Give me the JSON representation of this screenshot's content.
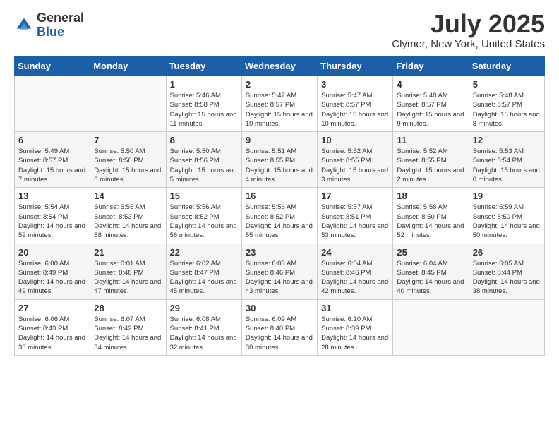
{
  "header": {
    "logo_line1": "General",
    "logo_line2": "Blue",
    "title": "July 2025",
    "location": "Clymer, New York, United States"
  },
  "weekdays": [
    "Sunday",
    "Monday",
    "Tuesday",
    "Wednesday",
    "Thursday",
    "Friday",
    "Saturday"
  ],
  "weeks": [
    [
      {
        "day": "",
        "sunrise": "",
        "sunset": "",
        "daylight": ""
      },
      {
        "day": "",
        "sunrise": "",
        "sunset": "",
        "daylight": ""
      },
      {
        "day": "1",
        "sunrise": "Sunrise: 5:46 AM",
        "sunset": "Sunset: 8:58 PM",
        "daylight": "Daylight: 15 hours and 11 minutes."
      },
      {
        "day": "2",
        "sunrise": "Sunrise: 5:47 AM",
        "sunset": "Sunset: 8:57 PM",
        "daylight": "Daylight: 15 hours and 10 minutes."
      },
      {
        "day": "3",
        "sunrise": "Sunrise: 5:47 AM",
        "sunset": "Sunset: 8:57 PM",
        "daylight": "Daylight: 15 hours and 10 minutes."
      },
      {
        "day": "4",
        "sunrise": "Sunrise: 5:48 AM",
        "sunset": "Sunset: 8:57 PM",
        "daylight": "Daylight: 15 hours and 9 minutes."
      },
      {
        "day": "5",
        "sunrise": "Sunrise: 5:48 AM",
        "sunset": "Sunset: 8:57 PM",
        "daylight": "Daylight: 15 hours and 8 minutes."
      }
    ],
    [
      {
        "day": "6",
        "sunrise": "Sunrise: 5:49 AM",
        "sunset": "Sunset: 8:57 PM",
        "daylight": "Daylight: 15 hours and 7 minutes."
      },
      {
        "day": "7",
        "sunrise": "Sunrise: 5:50 AM",
        "sunset": "Sunset: 8:56 PM",
        "daylight": "Daylight: 15 hours and 6 minutes."
      },
      {
        "day": "8",
        "sunrise": "Sunrise: 5:50 AM",
        "sunset": "Sunset: 8:56 PM",
        "daylight": "Daylight: 15 hours and 5 minutes."
      },
      {
        "day": "9",
        "sunrise": "Sunrise: 5:51 AM",
        "sunset": "Sunset: 8:55 PM",
        "daylight": "Daylight: 15 hours and 4 minutes."
      },
      {
        "day": "10",
        "sunrise": "Sunrise: 5:52 AM",
        "sunset": "Sunset: 8:55 PM",
        "daylight": "Daylight: 15 hours and 3 minutes."
      },
      {
        "day": "11",
        "sunrise": "Sunrise: 5:52 AM",
        "sunset": "Sunset: 8:55 PM",
        "daylight": "Daylight: 15 hours and 2 minutes."
      },
      {
        "day": "12",
        "sunrise": "Sunrise: 5:53 AM",
        "sunset": "Sunset: 8:54 PM",
        "daylight": "Daylight: 15 hours and 0 minutes."
      }
    ],
    [
      {
        "day": "13",
        "sunrise": "Sunrise: 5:54 AM",
        "sunset": "Sunset: 8:54 PM",
        "daylight": "Daylight: 14 hours and 59 minutes."
      },
      {
        "day": "14",
        "sunrise": "Sunrise: 5:55 AM",
        "sunset": "Sunset: 8:53 PM",
        "daylight": "Daylight: 14 hours and 58 minutes."
      },
      {
        "day": "15",
        "sunrise": "Sunrise: 5:56 AM",
        "sunset": "Sunset: 8:52 PM",
        "daylight": "Daylight: 14 hours and 56 minutes."
      },
      {
        "day": "16",
        "sunrise": "Sunrise: 5:56 AM",
        "sunset": "Sunset: 8:52 PM",
        "daylight": "Daylight: 14 hours and 55 minutes."
      },
      {
        "day": "17",
        "sunrise": "Sunrise: 5:57 AM",
        "sunset": "Sunset: 8:51 PM",
        "daylight": "Daylight: 14 hours and 53 minutes."
      },
      {
        "day": "18",
        "sunrise": "Sunrise: 5:58 AM",
        "sunset": "Sunset: 8:50 PM",
        "daylight": "Daylight: 14 hours and 52 minutes."
      },
      {
        "day": "19",
        "sunrise": "Sunrise: 5:59 AM",
        "sunset": "Sunset: 8:50 PM",
        "daylight": "Daylight: 14 hours and 50 minutes."
      }
    ],
    [
      {
        "day": "20",
        "sunrise": "Sunrise: 6:00 AM",
        "sunset": "Sunset: 8:49 PM",
        "daylight": "Daylight: 14 hours and 49 minutes."
      },
      {
        "day": "21",
        "sunrise": "Sunrise: 6:01 AM",
        "sunset": "Sunset: 8:48 PM",
        "daylight": "Daylight: 14 hours and 47 minutes."
      },
      {
        "day": "22",
        "sunrise": "Sunrise: 6:02 AM",
        "sunset": "Sunset: 8:47 PM",
        "daylight": "Daylight: 14 hours and 45 minutes."
      },
      {
        "day": "23",
        "sunrise": "Sunrise: 6:03 AM",
        "sunset": "Sunset: 8:46 PM",
        "daylight": "Daylight: 14 hours and 43 minutes."
      },
      {
        "day": "24",
        "sunrise": "Sunrise: 6:04 AM",
        "sunset": "Sunset: 8:46 PM",
        "daylight": "Daylight: 14 hours and 42 minutes."
      },
      {
        "day": "25",
        "sunrise": "Sunrise: 6:04 AM",
        "sunset": "Sunset: 8:45 PM",
        "daylight": "Daylight: 14 hours and 40 minutes."
      },
      {
        "day": "26",
        "sunrise": "Sunrise: 6:05 AM",
        "sunset": "Sunset: 8:44 PM",
        "daylight": "Daylight: 14 hours and 38 minutes."
      }
    ],
    [
      {
        "day": "27",
        "sunrise": "Sunrise: 6:06 AM",
        "sunset": "Sunset: 8:43 PM",
        "daylight": "Daylight: 14 hours and 36 minutes."
      },
      {
        "day": "28",
        "sunrise": "Sunrise: 6:07 AM",
        "sunset": "Sunset: 8:42 PM",
        "daylight": "Daylight: 14 hours and 34 minutes."
      },
      {
        "day": "29",
        "sunrise": "Sunrise: 6:08 AM",
        "sunset": "Sunset: 8:41 PM",
        "daylight": "Daylight: 14 hours and 32 minutes."
      },
      {
        "day": "30",
        "sunrise": "Sunrise: 6:09 AM",
        "sunset": "Sunset: 8:40 PM",
        "daylight": "Daylight: 14 hours and 30 minutes."
      },
      {
        "day": "31",
        "sunrise": "Sunrise: 6:10 AM",
        "sunset": "Sunset: 8:39 PM",
        "daylight": "Daylight: 14 hours and 28 minutes."
      },
      {
        "day": "",
        "sunrise": "",
        "sunset": "",
        "daylight": ""
      },
      {
        "day": "",
        "sunrise": "",
        "sunset": "",
        "daylight": ""
      }
    ]
  ]
}
